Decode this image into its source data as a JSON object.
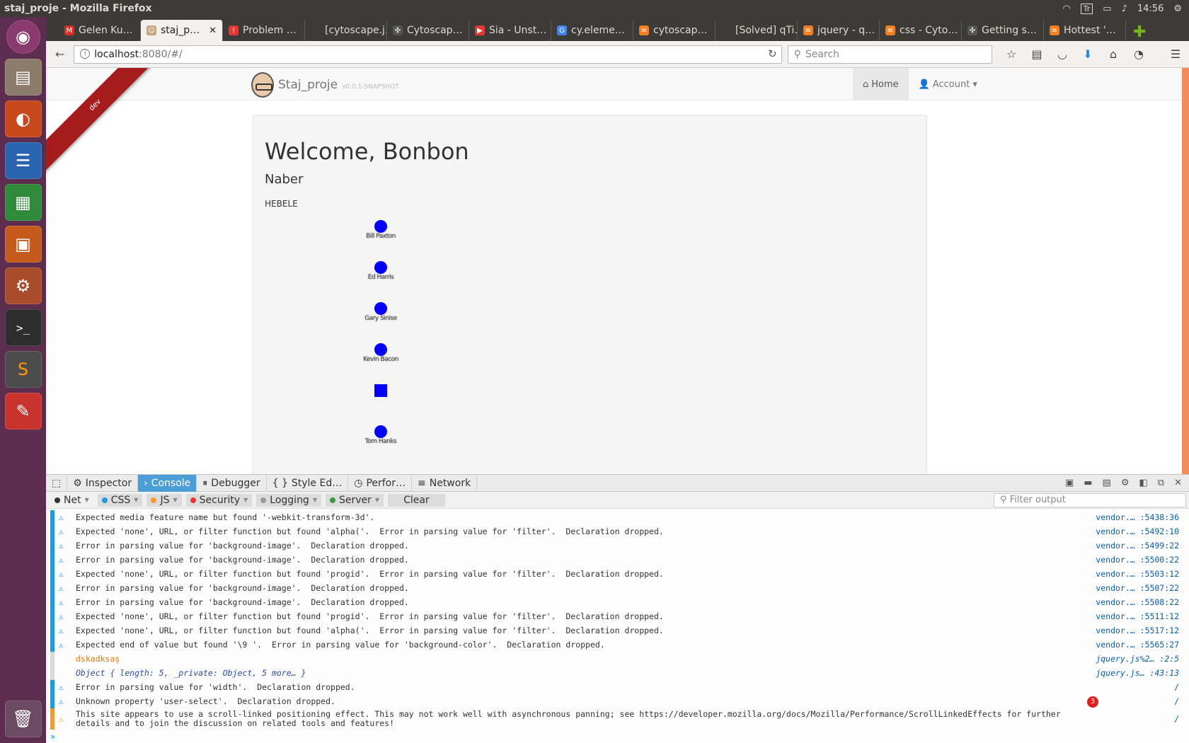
{
  "window": {
    "title": "staj_proje - Mozilla Firefox"
  },
  "tray": {
    "keyboard": "Tr",
    "clock": "14:56"
  },
  "launcher": [
    "ubuntu-dash",
    "files",
    "firefox",
    "writer",
    "calc",
    "impress",
    "system-settings",
    "terminal",
    "sublime-text",
    "pdf-viewer",
    "trash"
  ],
  "tabs": [
    {
      "label": "Gelen Ku…",
      "color": "#d93025",
      "glyph": "M"
    },
    {
      "label": "staj_p…",
      "color": "#c9a37a",
      "glyph": "☺",
      "active": true
    },
    {
      "label": "Problem …",
      "color": "#e53935",
      "glyph": "!"
    },
    {
      "label": "[cytoscape.j…",
      "color": "#3c3b37",
      "glyph": ""
    },
    {
      "label": "Cytoscap…",
      "color": "#555",
      "glyph": "✣"
    },
    {
      "label": "Sia - Unst…",
      "color": "#e53935",
      "glyph": "▶"
    },
    {
      "label": "cy.eleme…",
      "color": "#4285f4",
      "glyph": "G"
    },
    {
      "label": "cytoscap…",
      "color": "#f48024",
      "glyph": "≡"
    },
    {
      "label": "[Solved] qTi…",
      "color": "#3c3b37",
      "glyph": ""
    },
    {
      "label": "jquery - q…",
      "color": "#f48024",
      "glyph": "≡"
    },
    {
      "label": "css - Cyto…",
      "color": "#f48024",
      "glyph": "≡"
    },
    {
      "label": "Getting s…",
      "color": "#555",
      "glyph": "✣"
    },
    {
      "label": "Hottest '…",
      "color": "#f48024",
      "glyph": "≡"
    }
  ],
  "url": {
    "host": "localhost",
    "rest": ":8080/#/"
  },
  "search": {
    "placeholder": "Search"
  },
  "app": {
    "ribbon": "dev",
    "brand": "Staj_proje",
    "version": "v0.0.1-SNAPSHOT",
    "menu_home": "Home",
    "menu_account": "Account",
    "welcome": "Welcome, Bonbon",
    "subtitle": "Naber",
    "text": "HEBELE",
    "nodes": [
      {
        "label": "Bill Paxton",
        "shape": "circle"
      },
      {
        "label": "Ed Harris",
        "shape": "circle"
      },
      {
        "label": "Gary Sinise",
        "shape": "circle"
      },
      {
        "label": "Kevin Bacon",
        "shape": "circle"
      },
      {
        "label": "",
        "shape": "square"
      },
      {
        "label": "Tom Hanks",
        "shape": "circle"
      }
    ]
  },
  "devtools": {
    "tabs": {
      "inspector": "Inspector",
      "console": "Console",
      "debugger": "Debugger",
      "style": "Style Ed…",
      "perf": "Perfor…",
      "network": "Network"
    },
    "filters": {
      "net": "Net",
      "css": "CSS",
      "js": "JS",
      "security": "Security",
      "logging": "Logging",
      "server": "Server",
      "clear": "Clear",
      "filter_placeholder": "Filter output"
    },
    "warning_badge": "3",
    "lines": [
      {
        "type": "warn",
        "msg": "Expected media feature name but found '-webkit-transform-3d'.",
        "src": "vendor.… :5438:36"
      },
      {
        "type": "warn",
        "msg": "Expected 'none', URL, or filter function but found 'alpha('.  Error in parsing value for 'filter'.  Declaration dropped.",
        "src": "vendor.… :5492:10"
      },
      {
        "type": "warn",
        "msg": "Error in parsing value for 'background-image'.  Declaration dropped.",
        "src": "vendor.… :5499:22"
      },
      {
        "type": "warn",
        "msg": "Error in parsing value for 'background-image'.  Declaration dropped.",
        "src": "vendor.… :5500:22"
      },
      {
        "type": "warn",
        "msg": "Expected 'none', URL, or filter function but found 'progid'.  Error in parsing value for 'filter'.  Declaration dropped.",
        "src": "vendor.… :5503:12"
      },
      {
        "type": "warn",
        "msg": "Error in parsing value for 'background-image'.  Declaration dropped.",
        "src": "vendor.… :5507:22"
      },
      {
        "type": "warn",
        "msg": "Error in parsing value for 'background-image'.  Declaration dropped.",
        "src": "vendor.… :5508:22"
      },
      {
        "type": "warn",
        "msg": "Expected 'none', URL, or filter function but found 'progid'.  Error in parsing value for 'filter'.  Declaration dropped.",
        "src": "vendor.… :5511:12"
      },
      {
        "type": "warn",
        "msg": "Expected 'none', URL, or filter function but found 'alpha('.  Error in parsing value for 'filter'.  Declaration dropped.",
        "src": "vendor.… :5517:12"
      },
      {
        "type": "warn",
        "msg": "Expected end of value but found '\\9 '.  Error in parsing value for 'background-color'.  Declaration dropped.",
        "src": "vendor.… :5565:27"
      },
      {
        "type": "log",
        "msg": "dskadksaş",
        "src": "jquery.js%2… :2:5"
      },
      {
        "type": "obj",
        "msg": "Object { length: 5, _private: Object, 5 more… }",
        "src": "jquery.js… :43:13"
      },
      {
        "type": "warn",
        "msg": "Error in parsing value for 'width'.  Declaration dropped.",
        "src": "/"
      },
      {
        "type": "warn",
        "msg": "Unknown property 'user-select'.  Declaration dropped.",
        "src": "/"
      },
      {
        "type": "warn2",
        "msg": "This site appears to use a scroll-linked positioning effect. This may not work well with asynchronous panning; see https://developer.mozilla.org/docs/Mozilla/Performance/ScrollLinkedEffects for further details and to join the discussion on related tools and features!",
        "src": "/"
      }
    ],
    "prompt": "»"
  },
  "colors": {
    "console_blue": "#4c9ed9",
    "node_blue": "#0000ff",
    "launcher_bg": "#5c2d4e",
    "ribbon_red": "#a61c1c"
  }
}
